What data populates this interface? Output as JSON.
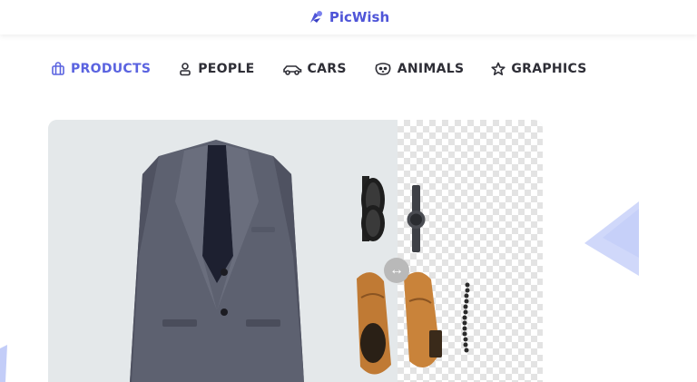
{
  "header": {
    "brand": "PicWish",
    "brand_color": "#4f55d8"
  },
  "tabs": [
    {
      "label": "PRODUCTS",
      "icon": "shopping-bag-icon",
      "active": true
    },
    {
      "label": "PEOPLE",
      "icon": "person-icon",
      "active": false
    },
    {
      "label": "CARS",
      "icon": "car-icon",
      "active": false
    },
    {
      "label": "ANIMALS",
      "icon": "animal-face-icon",
      "active": false
    },
    {
      "label": "GRAPHICS",
      "icon": "star-icon",
      "active": false
    }
  ],
  "colors": {
    "active_tab": "#5a63e0",
    "inactive_tab": "#2e2e36",
    "stage_bg": "#e4e8ea"
  }
}
